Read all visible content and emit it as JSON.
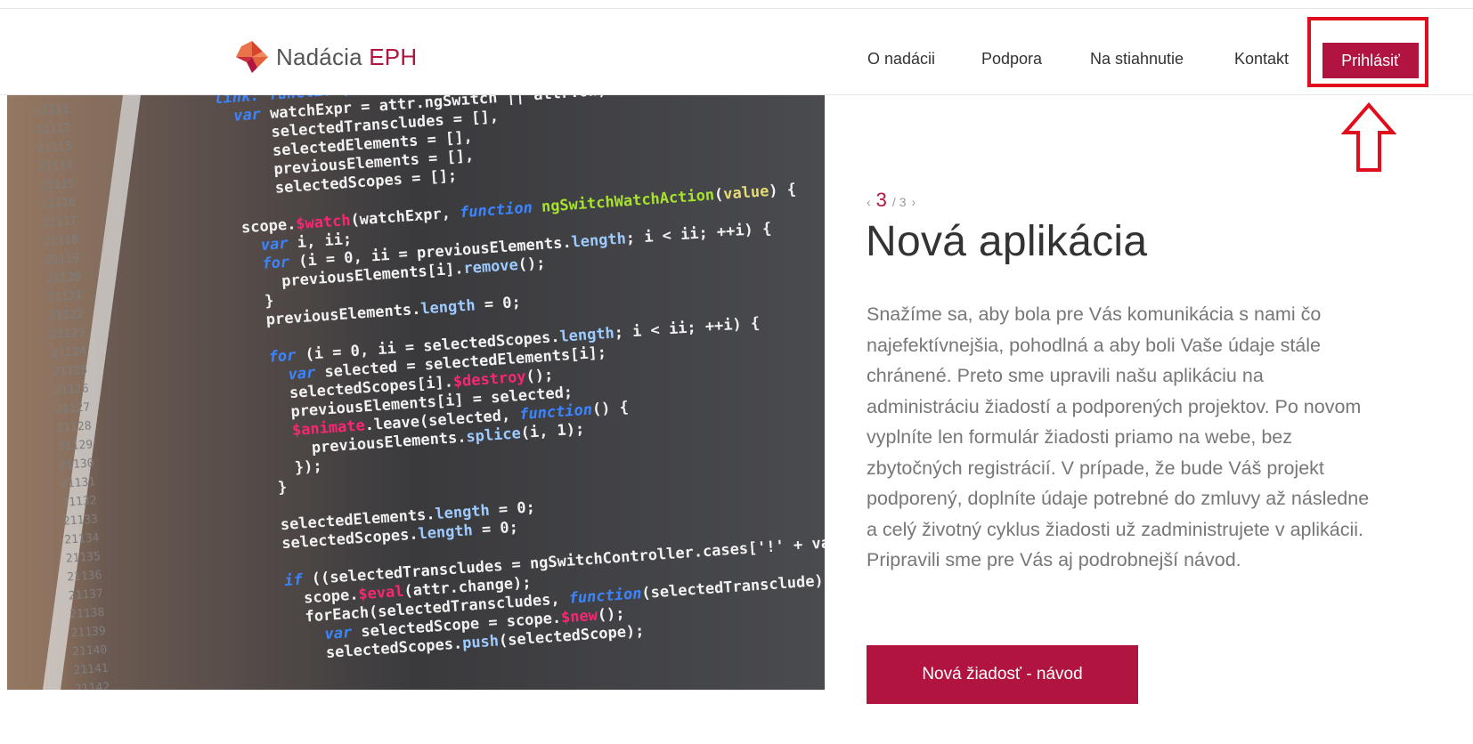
{
  "header": {
    "logo_text": "Nadácia",
    "logo_accent": "EPH",
    "nav": [
      {
        "label": "O nadácii"
      },
      {
        "label": "Podpora"
      },
      {
        "label": "Na stiahnutie"
      },
      {
        "label": "Kontakt"
      }
    ],
    "login_label": "Prihlásiť"
  },
  "slider": {
    "prev_icon": "‹",
    "next_icon": "›",
    "current": "3",
    "total": "/ 3",
    "title": "Nová aplikácia",
    "text": "Snažíme sa, aby bola pre Vás komunikácia s nami čo najefektívnejšia, pohodlná a aby boli Vaše údaje stále chránené. Preto sme upravili našu aplikáciu na administráciu žiadostí a podporených projektov. Po novom vyplníte len formulár žiadosti priamo na webe, bez zbytočných registrácií. V prípade, že bude Váš projekt podporený, doplníte údaje potrebné do zmluvy až následne a celý životný cyklus žiadosti už zadministrujete v aplikácii. Pripravili sme pre Vás aj podrobnejší návod.",
    "cta_label": "Nová žiadosť - návod"
  },
  "colors": {
    "brand": "#b0143f",
    "highlight": "#e00d1c"
  }
}
